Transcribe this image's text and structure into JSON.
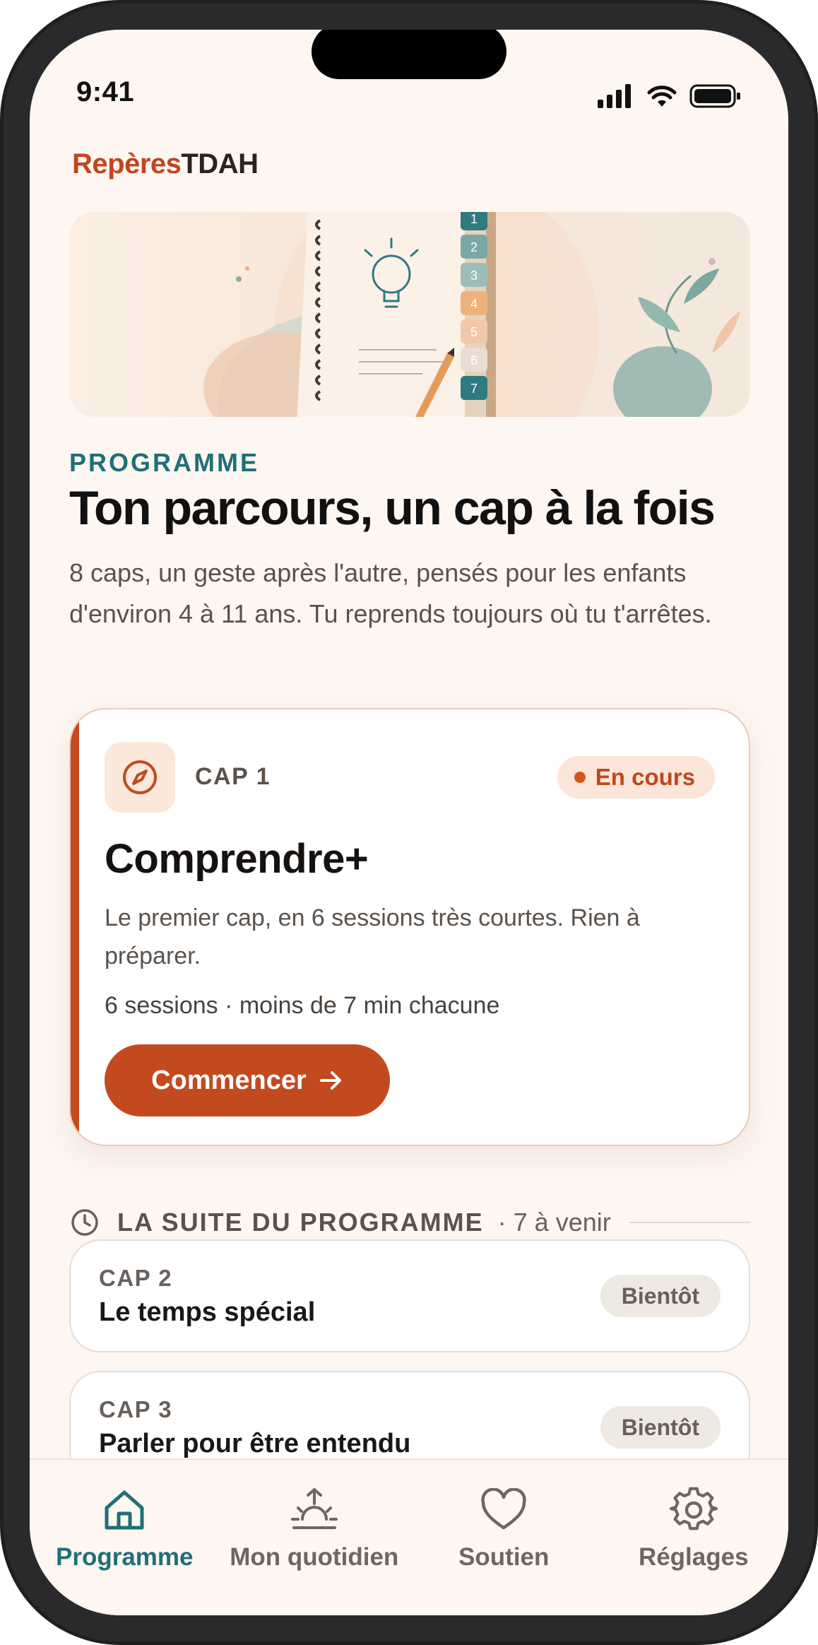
{
  "status_bar": {
    "time": "9:41"
  },
  "brand": {
    "part1": "Repères",
    "part2": "TDAH"
  },
  "program": {
    "kicker": "PROGRAMME",
    "title": "Ton parcours, un cap à la fois",
    "intro": "8 caps, un geste après l'autre, pensés pour les enfants d'environ 4 à 11 ans. Tu reprends toujours où tu t'arrêtes."
  },
  "current_cap": {
    "label": "CAP 1",
    "status": "En cours",
    "title": "Comprendre+",
    "description": "Le premier cap, en 6 sessions très courtes. Rien à préparer.",
    "meta": "6 sessions · moins de 7 min chacune",
    "button_label": "Commencer",
    "icon": "compass-icon"
  },
  "suite": {
    "label": "LA SUITE DU PROGRAMME",
    "count": "· 7 à venir"
  },
  "upcoming": [
    {
      "cap": "CAP 2",
      "title": "Le temps spécial",
      "badge": "Bientôt"
    },
    {
      "cap": "CAP 3",
      "title": "Parler pour être entendu",
      "badge": "Bientôt"
    }
  ],
  "tabs": [
    {
      "label": "Programme",
      "icon": "home-icon",
      "active": true
    },
    {
      "label": "Mon quotidien",
      "icon": "sunrise-icon",
      "active": false
    },
    {
      "label": "Soutien",
      "icon": "heart-icon",
      "active": false
    },
    {
      "label": "Réglages",
      "icon": "gear-icon",
      "active": false
    }
  ],
  "hero_steps": [
    "1",
    "2",
    "3",
    "4",
    "5",
    "6",
    "7"
  ],
  "colors": {
    "accent": "#c24a1e",
    "teal": "#1f6f78",
    "background": "#fdf6f1"
  }
}
